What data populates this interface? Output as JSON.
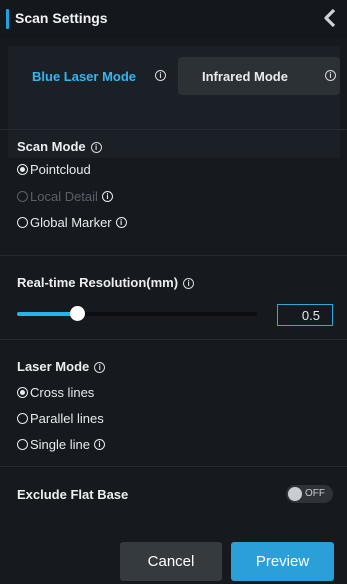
{
  "header": {
    "title": "Scan Settings",
    "collapse_icon": "chevron-left-icon"
  },
  "colors": {
    "accent": "#1fa3e0",
    "active_tab_text": "#35b6ef",
    "primary_button": "#2a9fd8",
    "background": "#161a1f"
  },
  "modes": {
    "blue_laser_label": "Blue Laser Mode",
    "infrared_label": "Infrared Mode",
    "info_glyph": "i"
  },
  "scan_mode": {
    "title": "Scan Mode",
    "options": [
      {
        "label": "Pointcloud",
        "selected": true,
        "disabled": false
      },
      {
        "label": "Local Detail",
        "selected": false,
        "disabled": true
      },
      {
        "label": "Global Marker",
        "selected": false,
        "disabled": false
      }
    ]
  },
  "resolution": {
    "title": "Real-time Resolution(mm)",
    "value": "0.5",
    "slider_fraction": 0.23
  },
  "laser_mode": {
    "title": "Laser Mode",
    "options": [
      {
        "label": "Cross lines",
        "selected": true
      },
      {
        "label": "Parallel lines",
        "selected": false
      },
      {
        "label": "Single line",
        "selected": false
      }
    ]
  },
  "exclude_flat_base": {
    "label": "Exclude Flat Base",
    "state": "OFF"
  },
  "footer": {
    "cancel_label": "Cancel",
    "preview_label": "Preview"
  }
}
